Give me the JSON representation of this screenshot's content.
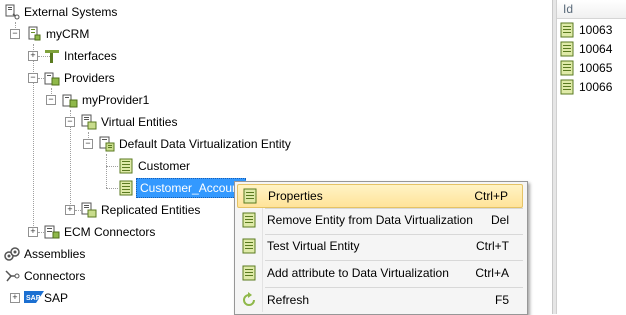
{
  "tree": {
    "root": "External Systems",
    "system": "myCRM",
    "interfaces": "Interfaces",
    "providers": "Providers",
    "provider": "myProvider1",
    "virtual_entities": "Virtual Entities",
    "default_entity": "Default Data Virtualization Entity",
    "customer": "Customer",
    "customer_account": "Customer_Account",
    "replicated_entities": "Replicated Entities",
    "ecm_connectors": "ECM Connectors",
    "assemblies": "Assemblies",
    "connectors": "Connectors",
    "sap": "SAP",
    "sap_logo_text": "SAP"
  },
  "ids": {
    "header": "Id",
    "rows": [
      "10063",
      "10064",
      "10065",
      "10066"
    ]
  },
  "context_menu": {
    "items": [
      {
        "label": "Properties",
        "shortcut": "Ctrl+P",
        "icon": "grid-icon"
      },
      {
        "label": "Remove Entity from Data Virtualization",
        "shortcut": "Del",
        "icon": "grid-icon"
      },
      {
        "label": "Test Virtual Entity",
        "shortcut": "Ctrl+T",
        "icon": "grid-icon"
      },
      {
        "label": "Add attribute to Data Virtualization",
        "shortcut": "Ctrl+A",
        "icon": "grid-icon"
      },
      {
        "label": "Refresh",
        "shortcut": "F5",
        "icon": "refresh-icon"
      }
    ]
  },
  "colors": {
    "selection": "#3399ff",
    "menu_highlight": "#ffe39a",
    "entity_icon": "#7fa23c"
  }
}
